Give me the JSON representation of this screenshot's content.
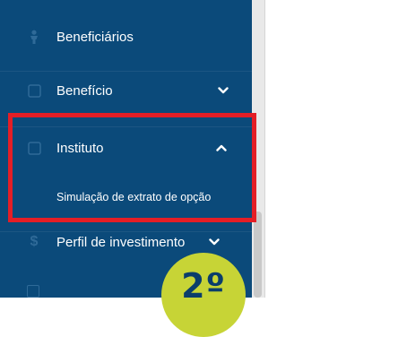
{
  "sidebar": {
    "items": [
      {
        "label": "Beneficiários",
        "icon": "person-icon"
      },
      {
        "label": "Benefício",
        "icon": "document-icon",
        "chevron": "chevron-down-icon"
      },
      {
        "label": "Instituto",
        "icon": "document-icon",
        "chevron": "chevron-up-icon",
        "subitems": [
          {
            "label": "Simulação de extrato de opção"
          }
        ]
      },
      {
        "label": "Perfil de investimento",
        "icon": "dollar-icon",
        "chevron": "chevron-down-icon"
      }
    ]
  },
  "annotation": {
    "step_label": "2º"
  },
  "colors": {
    "sidebar_bg": "#0b4a7a",
    "icon_dim": "#2f6a98",
    "highlight": "#e41e26",
    "badge_bg": "#c7d436",
    "badge_text": "#0b3e6b"
  }
}
